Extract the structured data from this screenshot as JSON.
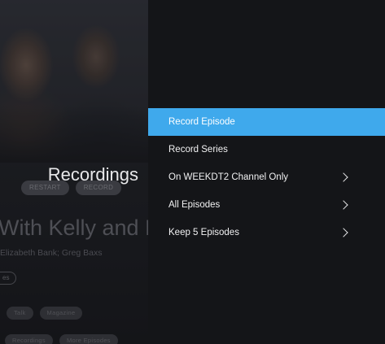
{
  "background": {
    "title": "Recordings",
    "top_chips": [
      "RESTART",
      "RECORD"
    ],
    "show_title": "With Kelly and R",
    "show_cast": "Elizabeth Bank; Greg Baxs",
    "more_label": "es",
    "genres": [
      "Talk",
      "Magazine"
    ],
    "bottom_chips": [
      "Recordings",
      "More Episodes"
    ]
  },
  "menu": {
    "items": [
      {
        "label": "Record Episode",
        "selected": true,
        "has_chevron": false
      },
      {
        "label": "Record Series",
        "selected": false,
        "has_chevron": false
      },
      {
        "label": "On WEEKDT2 Channel Only",
        "selected": false,
        "has_chevron": true
      },
      {
        "label": "All Episodes",
        "selected": false,
        "has_chevron": true
      },
      {
        "label": "Keep 5 Episodes",
        "selected": false,
        "has_chevron": true
      }
    ]
  },
  "colors": {
    "accent": "#3fa9ec",
    "panel": "#141518",
    "text": "#f2f2f3"
  }
}
